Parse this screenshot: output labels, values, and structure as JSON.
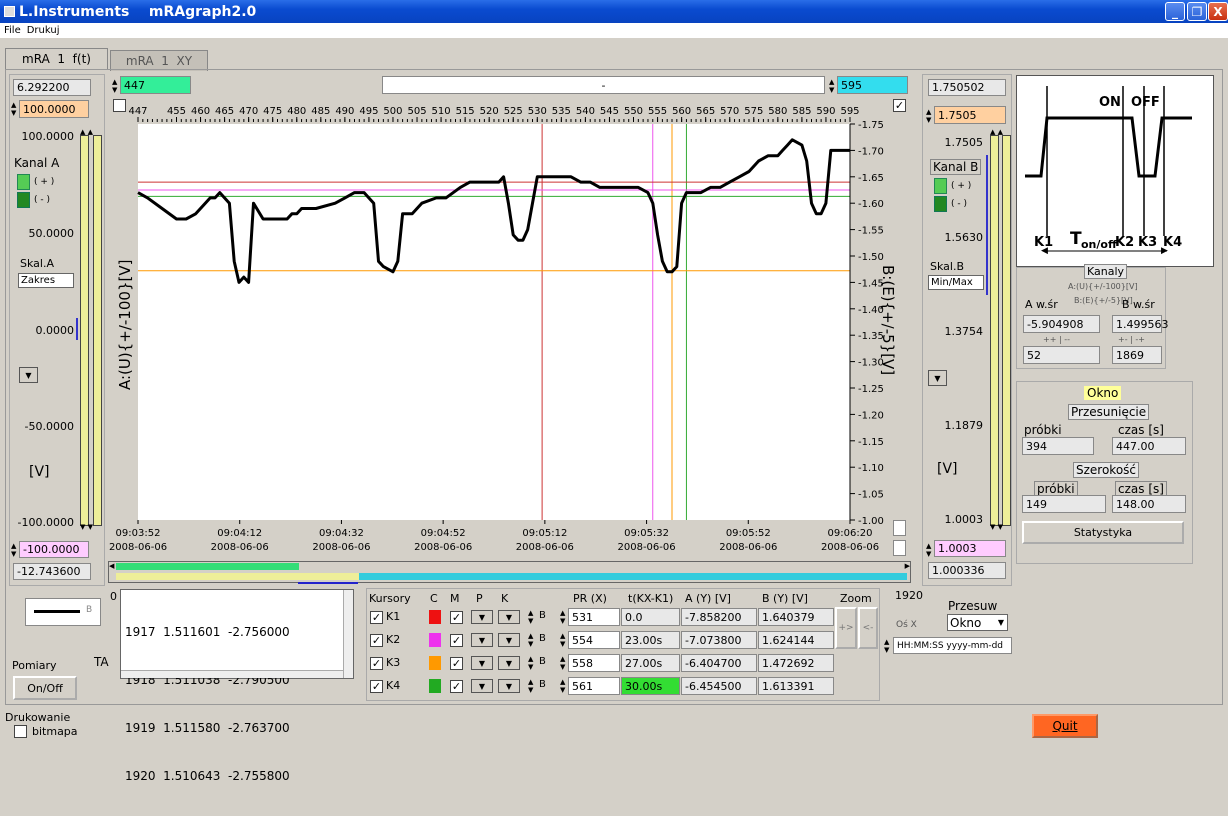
{
  "window": {
    "title": "L.Instruments    mRAgraph2.0",
    "min": "_",
    "max": "❐",
    "close": "X"
  },
  "menu": [
    "File",
    "Drukuj"
  ],
  "tabs": [
    {
      "label": "mRA  1  f(t)"
    },
    {
      "label": "mRA  1  XY"
    }
  ],
  "left": {
    "top_value": "6.292200",
    "max_field": "100.0000",
    "ticks": [
      "100.0000",
      "50.0000",
      "0.0000",
      "-50.0000",
      "-100.0000"
    ],
    "kanal": "Kanal A",
    "plus": "( + )",
    "minus": "( - )",
    "skal_label": "Skal.A",
    "skal_value": "Zakres",
    "unit": "[V]",
    "min_field": "-100.0000",
    "bottom_value": "-12.743600",
    "legend_label": "B",
    "pomiary": "Pomiary",
    "onoff": "On/Off",
    "ta": "TA",
    "drukowanie": "Drukowanie",
    "bitmapa": "bitmapa"
  },
  "right": {
    "top_value": "1.750502",
    "max_field": "1.7505",
    "ticks": [
      "1.7505",
      "1.5630",
      "1.3754",
      "1.1879",
      "1.0003"
    ],
    "kanal": "Kanal B",
    "plus": "( + )",
    "minus": "( - )",
    "skal_label": "Skal.B",
    "skal_value": "Min/Max",
    "unit": "[V]",
    "min_field": "1.0003",
    "bottom_value": "1.000336"
  },
  "chart_header": {
    "start": "447",
    "center": "-",
    "end": "595"
  },
  "chart_data": {
    "type": "line",
    "xticks": [
      "447",
      "455",
      "460",
      "465",
      "470",
      "475",
      "480",
      "485",
      "490",
      "495",
      "500",
      "505",
      "510",
      "515",
      "520",
      "525",
      "530",
      "535",
      "540",
      "545",
      "550",
      "555",
      "560",
      "565",
      "570",
      "575",
      "580",
      "585",
      "590",
      "595"
    ],
    "time_ticks": [
      [
        "09:03:52",
        "2008-06-06"
      ],
      [
        "09:04:12",
        "2008-06-06"
      ],
      [
        "09:04:32",
        "2008-06-06"
      ],
      [
        "09:04:52",
        "2008-06-06"
      ],
      [
        "09:05:12",
        "2008-06-06"
      ],
      [
        "09:05:32",
        "2008-06-06"
      ],
      [
        "09:05:52",
        "2008-06-06"
      ],
      [
        "09:06:20",
        "2008-06-06"
      ]
    ],
    "yticks_right": [
      "-1.75",
      "-1.70",
      "-1.65",
      "-1.60",
      "-1.55",
      "-1.50",
      "-1.45",
      "-1.40",
      "-1.35",
      "-1.30",
      "-1.25",
      "-1.20",
      "-1.15",
      "-1.10",
      "-1.05",
      "-1.00"
    ],
    "ylabel_left": "A:(U){+/-100}[V]",
    "ylabel_right": "B:(E){+/-5}[V]",
    "xlim": [
      447,
      595
    ],
    "ylim": [
      -1.75,
      -1.0
    ],
    "series": [
      {
        "x": [
          447,
          449,
          452,
          455,
          457,
          459,
          460,
          462,
          463,
          464,
          466,
          467,
          468,
          469,
          470,
          471,
          473,
          475,
          478,
          479,
          480,
          481,
          484,
          488,
          490,
          492,
          494,
          496,
          497,
          498,
          500,
          501,
          502,
          504,
          506,
          509,
          511,
          514,
          516,
          520,
          521,
          522,
          523,
          524,
          525,
          526,
          527,
          528,
          529,
          530,
          532,
          535,
          537,
          539,
          541,
          543,
          545,
          547,
          549,
          551,
          553,
          554,
          555,
          556,
          557,
          558,
          559,
          560,
          561,
          562,
          563,
          564,
          566,
          568,
          570,
          572,
          574,
          576,
          578,
          580,
          581,
          582,
          583,
          585,
          586,
          587,
          588,
          589,
          590,
          591,
          592,
          593,
          595
        ],
        "y": [
          -1.62,
          -1.61,
          -1.59,
          -1.57,
          -1.57,
          -1.58,
          -1.59,
          -1.61,
          -1.61,
          -1.62,
          -1.6,
          -1.49,
          -1.45,
          -1.46,
          -1.45,
          -1.6,
          -1.57,
          -1.57,
          -1.57,
          -1.58,
          -1.58,
          -1.59,
          -1.59,
          -1.6,
          -1.61,
          -1.62,
          -1.62,
          -1.6,
          -1.49,
          -1.48,
          -1.47,
          -1.49,
          -1.58,
          -1.58,
          -1.6,
          -1.61,
          -1.61,
          -1.63,
          -1.64,
          -1.64,
          -1.64,
          -1.64,
          -1.65,
          -1.6,
          -1.54,
          -1.53,
          -1.53,
          -1.55,
          -1.6,
          -1.65,
          -1.65,
          -1.65,
          -1.65,
          -1.64,
          -1.64,
          -1.63,
          -1.63,
          -1.63,
          -1.63,
          -1.63,
          -1.62,
          -1.6,
          -1.54,
          -1.49,
          -1.47,
          -1.47,
          -1.48,
          -1.6,
          -1.62,
          -1.62,
          -1.62,
          -1.62,
          -1.63,
          -1.63,
          -1.64,
          -1.65,
          -1.66,
          -1.68,
          -1.69,
          -1.69,
          -1.7,
          -1.71,
          -1.72,
          -1.71,
          -1.68,
          -1.6,
          -1.58,
          -1.58,
          -1.6,
          -1.7,
          -1.7,
          -1.7,
          -1.7
        ],
        "color": "#000000"
      }
    ],
    "cursor_lines": [
      {
        "x": 531,
        "color": "#cc3333"
      },
      {
        "x": 554,
        "color": "#ee55ee"
      },
      {
        "x": 558,
        "color": "#ff9900"
      },
      {
        "x": 561,
        "color": "#33aa33"
      }
    ],
    "hlines": [
      {
        "y": -1.64,
        "color": "#cc3333"
      },
      {
        "y": -1.625,
        "color": "#ee55ee"
      },
      {
        "y": -1.472,
        "color": "#ff9900"
      },
      {
        "x": 0,
        "y": -1.613,
        "color": "#33aa33"
      }
    ],
    "grid": false
  },
  "datalist": [
    "1917  1.511601  -2.756000",
    "1918  1.511038  -2.790500",
    "1919  1.511580  -2.763700",
    "1920  1.510643  -2.755800"
  ],
  "list_zero": "0",
  "list_max": "1920",
  "cursors": {
    "headers": {
      "kursory": "Kursory",
      "c": "C",
      "m": "M",
      "p": "P",
      "k": "K",
      "pr": "PR (X)",
      "t": "t(KX-K1)",
      "a": "A (Y) [V]",
      "b": "B (Y) [V]",
      "zoom": "Zoom"
    },
    "rows": [
      {
        "name": "K1",
        "color": "#ee1111",
        "ab": "B",
        "pr": "531",
        "t": "0.0",
        "a": "-7.858200",
        "b": "1.640379"
      },
      {
        "name": "K2",
        "color": "#ee33ee",
        "ab": "B",
        "pr": "554",
        "t": "23.00s",
        "a": "-7.073800",
        "b": "1.624144"
      },
      {
        "name": "K3",
        "color": "#ff9900",
        "ab": "B",
        "pr": "558",
        "t": "27.00s",
        "a": "-6.404700",
        "b": "1.472692"
      },
      {
        "name": "K4",
        "color": "#22aa22",
        "ab": "B",
        "pr": "561",
        "t": "30.00s",
        "a": "-6.454500",
        "b": "1.613391"
      }
    ],
    "zoom_in": "+>",
    "zoom_out": "<-"
  },
  "przesuw": {
    "label": "Przesuw",
    "value": "Okno",
    "os_x": "Oś X",
    "format": "HH:MM:SS yyyy-mm-dd"
  },
  "diagram": {
    "on": "ON",
    "off": "OFF",
    "k1": "K1",
    "k2": "K2",
    "k3": "K3",
    "k4": "K4",
    "t": "T",
    "t_sub": "on/off"
  },
  "kanaly": {
    "title": "Kanaly",
    "sub1": "A:(U){+/-100}[V]",
    "sub2": "B:(E){+/-5}[V]",
    "a_label": "A w.śr",
    "b_label": "B w.śr",
    "a_value": "-5.904908",
    "b_value": "1.499563",
    "a_small": "++ | --",
    "b_small": "+- | -+",
    "a_count": "52",
    "b_count": "1869"
  },
  "okno": {
    "title": "Okno",
    "przes": "Przesunięcie",
    "probki1": "próbki",
    "czas1": "czas [s]",
    "probki_val1": "394",
    "czas_val1": "447.00",
    "szer": "Szerokość",
    "probki2": "próbki",
    "czas2": "czas [s]",
    "probki_val2": "149",
    "czas_val2": "148.00",
    "stat": "Statystyka"
  },
  "quit": "Quit"
}
